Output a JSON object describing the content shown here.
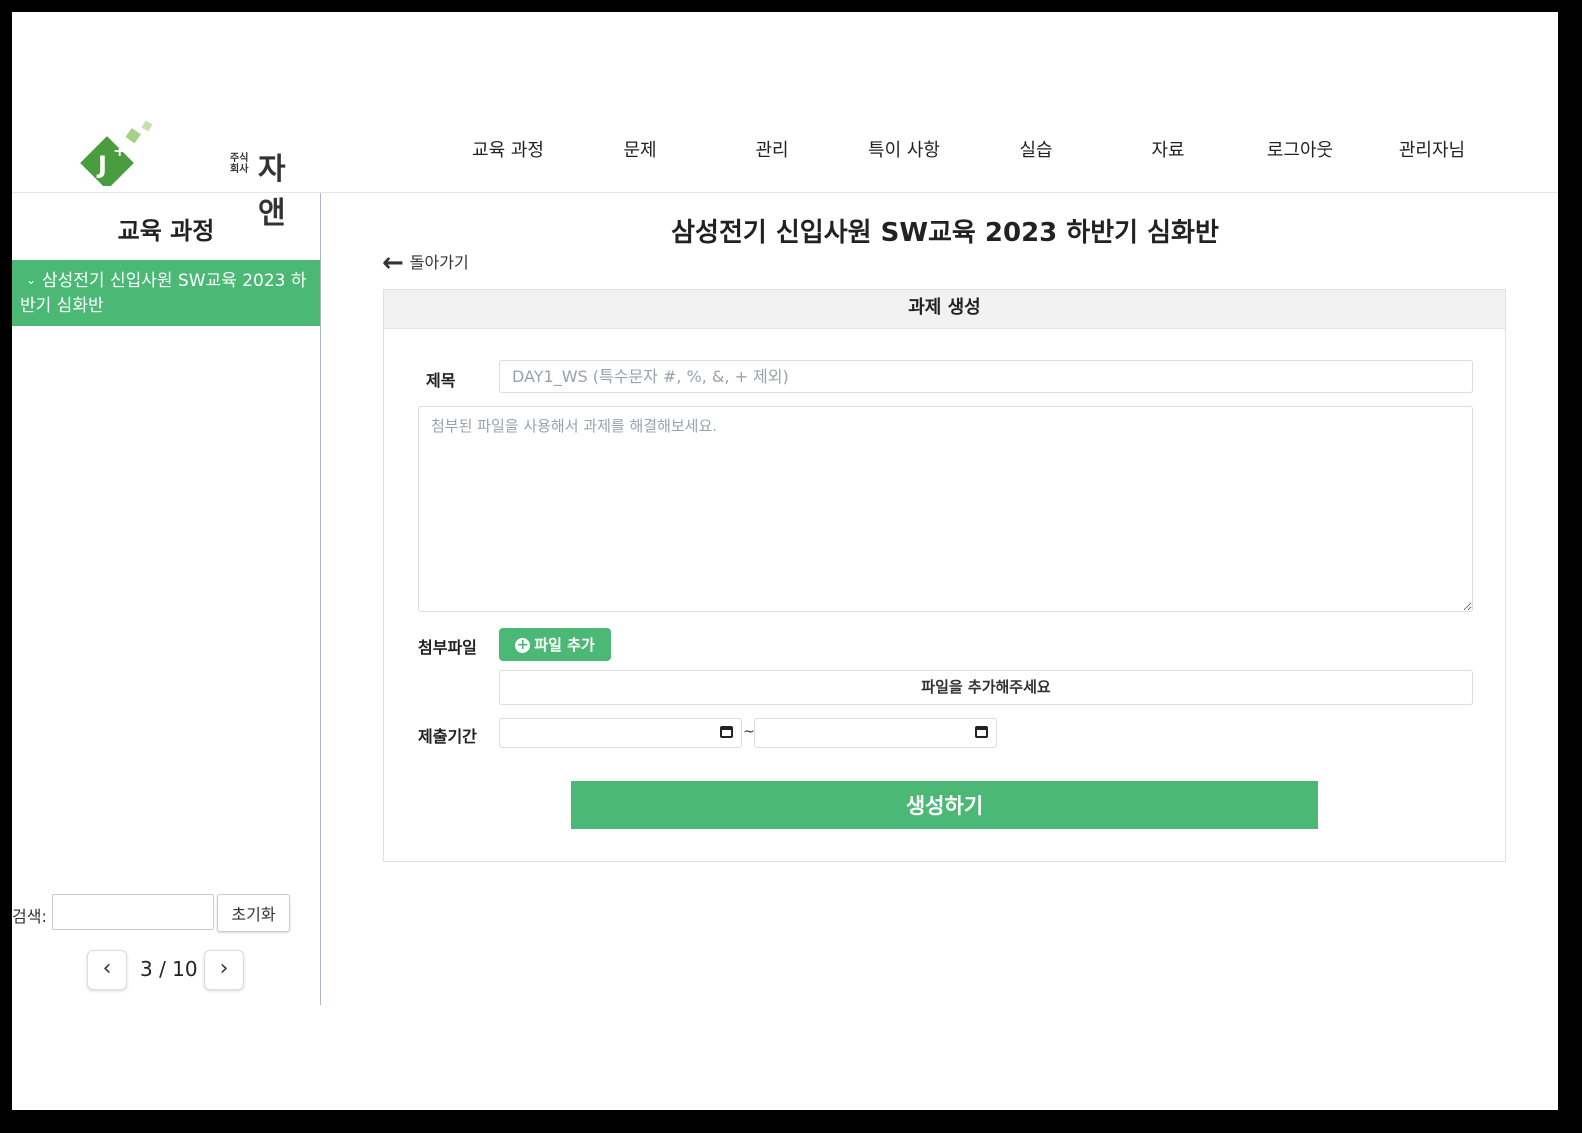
{
  "header": {
    "logo_small_top": "주식",
    "logo_small_bottom": "회사",
    "logo_name": "자앤",
    "logo_mark_text": "J",
    "nav": [
      "교육 과정",
      "문제",
      "관리",
      "특이 사항",
      "실습",
      "자료",
      "로그아웃",
      "관리자님"
    ]
  },
  "sidebar": {
    "title": "교육 과정",
    "items": [
      {
        "label_line1": "삼성전기 신입사원 SW교육 2023 하",
        "label_line2": "반기 심화반"
      }
    ],
    "search_label": "검색:",
    "search_value": "",
    "reset_label": "초기화",
    "pagination": {
      "text": "3 / 10",
      "prev_icon": "chevron-left",
      "next_icon": "chevron-right"
    }
  },
  "main": {
    "page_title": "삼성전기 신입사원 SW교육 2023 하반기 심화반",
    "back_label": "돌아가기",
    "card_title": "과제 생성",
    "title_label": "제목",
    "title_placeholder": "DAY1_WS (특수문자 #, %, &, + 제외)",
    "desc_placeholder": "첨부된 파일을 사용해서 과제를 해결해보세요.",
    "attach_label": "첨부파일",
    "add_file_label": "파일 추가",
    "file_empty_text": "파일을 추가해주세요",
    "period_label": "제출기간",
    "period_separator": "~",
    "submit_label": "생성하기"
  },
  "colors": {
    "accent": "#4bb975",
    "logo_dark": "#3f9b45",
    "logo_light": "#a8cf8a"
  }
}
